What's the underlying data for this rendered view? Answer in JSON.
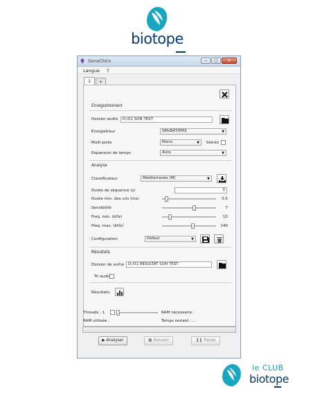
{
  "logos": {
    "top_wordmark": "biotope",
    "bottom_club": "le CLUB",
    "bottom_wordmark": "biotope"
  },
  "window": {
    "title": "SonoChiro",
    "controls": [
      "—",
      "□",
      "✕"
    ]
  },
  "menu": {
    "items": [
      "Langue",
      "?"
    ]
  },
  "tabs": [
    "1",
    "+"
  ],
  "enregistrement": {
    "section_label": "Enregistrement",
    "dossier_audio_label": "Dossier audio",
    "dossier_audio_value": "D:/01 SON TEST",
    "enregistreur_label": "Enregistreur",
    "enregistreur_value": "SMxBAT/EM3",
    "multipiste_label": "Multi-piste",
    "multipiste_value": "Mono",
    "stereo_label": "Stéréo",
    "expansion_label": "Expansion de temps",
    "expansion_value": "Auto"
  },
  "analyse": {
    "section_label": "Analyse",
    "classificateur_label": "Classificateur",
    "classificateur_value": "Méditerranée (M)",
    "duree_sequence_label": "Durée de séquence (s)",
    "duree_sequence_value": "0",
    "sliders": [
      {
        "label": "Durée min. des cris (ms)",
        "value": "0.5",
        "level": 0.05
      },
      {
        "label": "Sensibilité",
        "value": "7",
        "level": 0.6
      },
      {
        "label": "Freq. min. (kHz)",
        "value": "10",
        "level": 0.13
      },
      {
        "label": "Freq. max. (kHz)",
        "value": "140",
        "level": 0.58
      }
    ],
    "configuration_label": "Configuration",
    "configuration_value": "Défaut"
  },
  "resultats": {
    "section_label": "Résultats",
    "dossier_sortie_label": "Dossier de sortie",
    "dossier_sortie_value": "D:/01 RESULTAT SON TEST",
    "tri_audio_label": "Tri audio",
    "resultats_label": "Résultats:"
  },
  "status": {
    "threads_label": "Threads : 1",
    "ram_necessaire_label": "RAM nécessaire :",
    "ram_utilisee_label": "RAM utilisée :",
    "temps_restant_label": "Temps restant : ..."
  },
  "actions": {
    "analyser": "Analyser",
    "annuler": "Annuler",
    "pause": "Pause"
  },
  "colors": {
    "brand_dark": "#0a3a67",
    "brand_light": "#1a9db3",
    "window_title_bg": "#d4e1f0"
  }
}
